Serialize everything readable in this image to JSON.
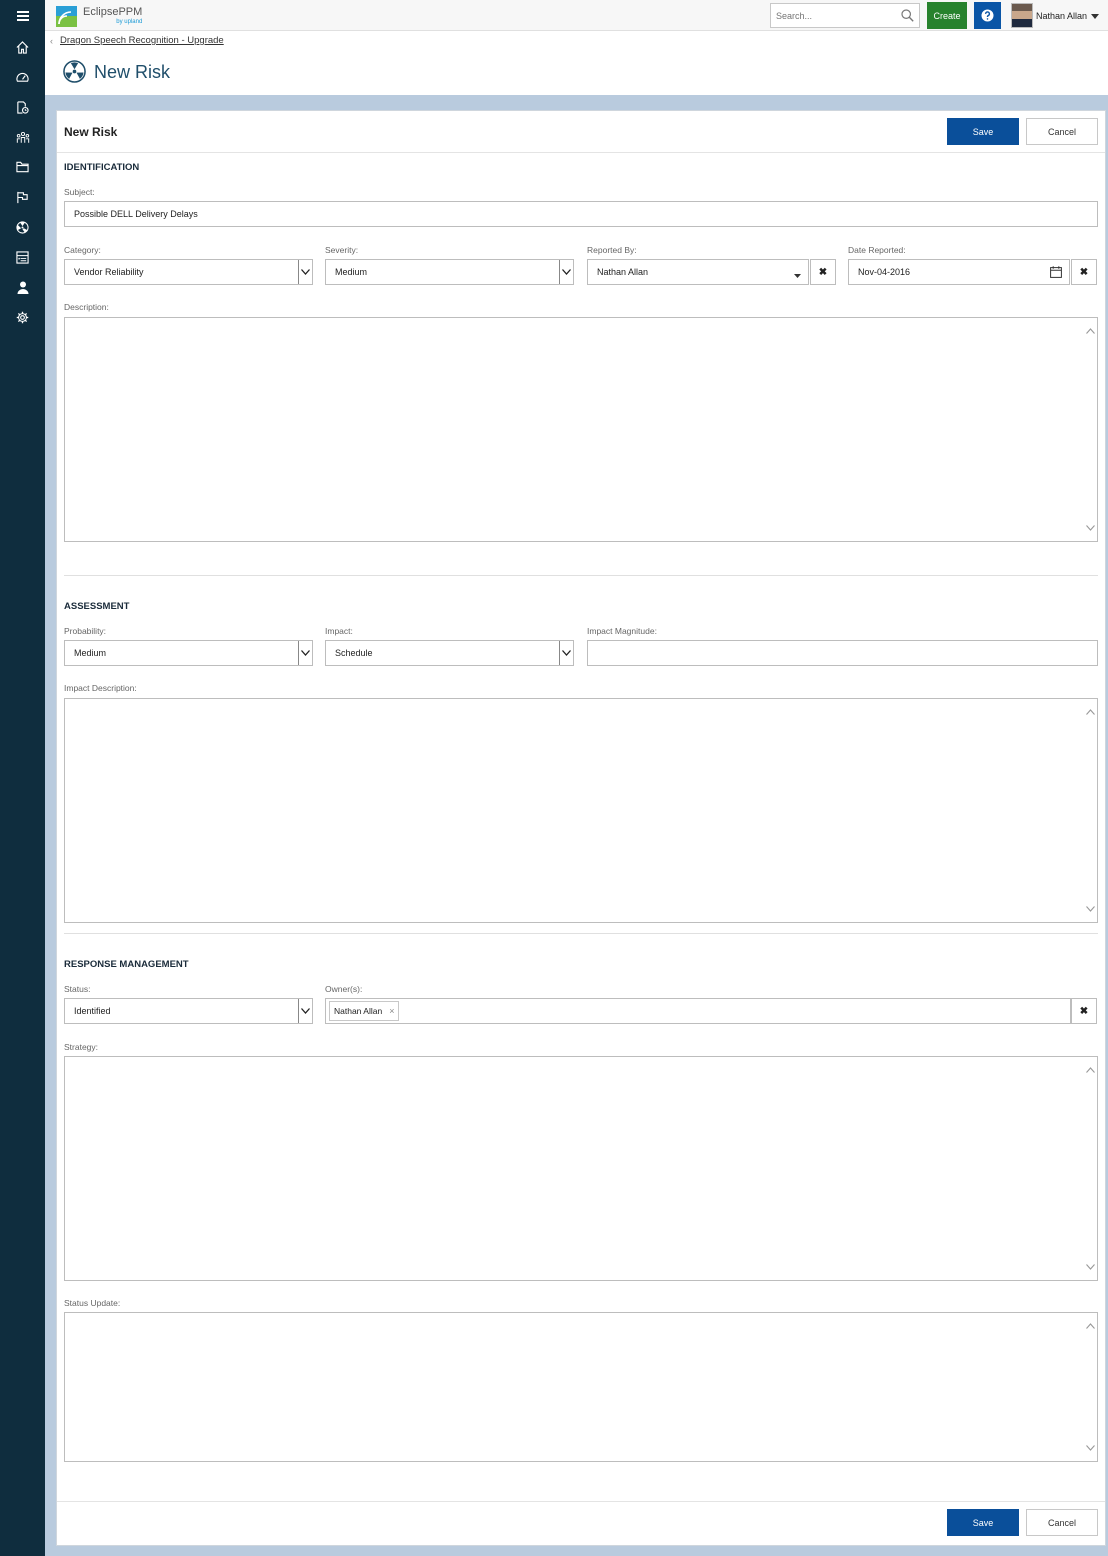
{
  "app": {
    "brand": "EclipsePPM",
    "brand_sub": "by upland"
  },
  "topbar": {
    "search_placeholder": "Search...",
    "create_label": "Create",
    "help_icon": "question-icon",
    "user_name": "Nathan Allan"
  },
  "sidebar": {
    "items": [
      "home-icon",
      "dashboard-icon",
      "projects-icon",
      "resources-icon",
      "folder-icon",
      "flag-icon",
      "risk-icon",
      "timesheet-icon",
      "user-icon",
      "settings-icon"
    ]
  },
  "breadcrumb": {
    "parent": "Dragon Speech Recognition - Upgrade"
  },
  "page": {
    "title": "New Risk",
    "icon": "radiation-icon"
  },
  "form": {
    "title": "New Risk",
    "save_label": "Save",
    "cancel_label": "Cancel",
    "identification": {
      "heading": "IDENTIFICATION",
      "subject_label": "Subject:",
      "subject_value": "Possible DELL Delivery Delays",
      "category_label": "Category:",
      "category_value": "Vendor Reliability",
      "severity_label": "Severity:",
      "severity_value": "Medium",
      "reported_by_label": "Reported By:",
      "reported_by_value": "Nathan Allan",
      "date_reported_label": "Date Reported:",
      "date_reported_value": "Nov-04-2016",
      "description_label": "Description:"
    },
    "assessment": {
      "heading": "ASSESSMENT",
      "probability_label": "Probability:",
      "probability_value": "Medium",
      "impact_label": "Impact:",
      "impact_value": "Schedule",
      "impact_magnitude_label": "Impact Magnitude:",
      "impact_description_label": "Impact Description:"
    },
    "response": {
      "heading": "RESPONSE MANAGEMENT",
      "status_label": "Status:",
      "status_value": "Identified",
      "owners_label": "Owner(s):",
      "owners": [
        "Nathan Allan"
      ],
      "strategy_label": "Strategy:",
      "status_update_label": "Status Update:"
    }
  },
  "colors": {
    "sidebar": "#0f2d3e",
    "primary": "#0a4f9a",
    "create": "#27822d",
    "band": "#b9cbde",
    "title": "#1f4e6a"
  }
}
